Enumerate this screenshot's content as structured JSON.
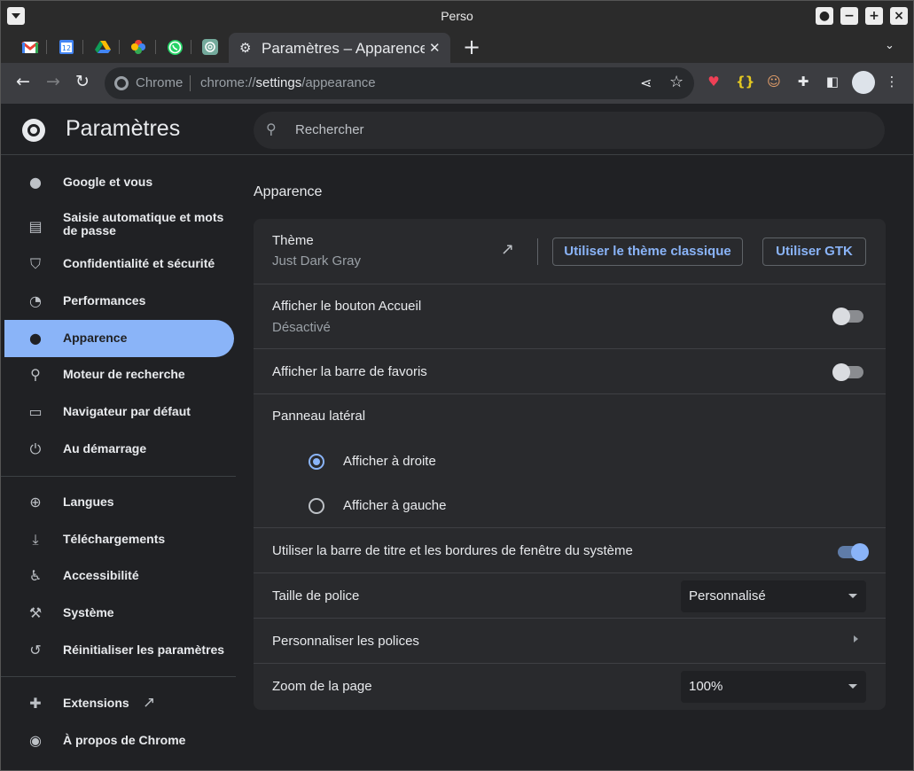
{
  "window": {
    "title": "Perso"
  },
  "tabs": {
    "pinned": [
      "gmail-icon",
      "calendar-icon",
      "drive-icon",
      "photos-icon",
      "whatsapp-icon",
      "chatgpt-icon"
    ],
    "active_title": "Paramètres – Apparence"
  },
  "toolbar": {
    "chrome_label": "Chrome",
    "url_scheme": "chrome://",
    "url_host": "settings",
    "url_path": "/appearance"
  },
  "header": {
    "title": "Paramètres",
    "search_placeholder": "Rechercher"
  },
  "sidebar": {
    "items": [
      {
        "label": "Google et vous",
        "icon": "person-icon"
      },
      {
        "label": "Saisie automatique et mots de passe",
        "icon": "clipboard-icon"
      },
      {
        "label": "Confidentialité et sécurité",
        "icon": "shield-icon"
      },
      {
        "label": "Performances",
        "icon": "gauge-icon"
      },
      {
        "label": "Apparence",
        "icon": "palette-icon"
      },
      {
        "label": "Moteur de recherche",
        "icon": "search-icon"
      },
      {
        "label": "Navigateur par défaut",
        "icon": "browser-icon"
      },
      {
        "label": "Au démarrage",
        "icon": "power-icon"
      },
      {
        "label": "Langues",
        "icon": "globe-icon"
      },
      {
        "label": "Téléchargements",
        "icon": "download-icon"
      },
      {
        "label": "Accessibilité",
        "icon": "accessibility-icon"
      },
      {
        "label": "Système",
        "icon": "wrench-icon"
      },
      {
        "label": "Réinitialiser les paramètres",
        "icon": "restore-icon"
      },
      {
        "label": "Extensions",
        "icon": "puzzle-icon"
      },
      {
        "label": "À propos de Chrome",
        "icon": "chrome-icon"
      }
    ]
  },
  "main": {
    "section_title": "Apparence",
    "theme": {
      "title": "Thème",
      "value": "Just Dark Gray",
      "classic_button": "Utiliser le thème classique",
      "gtk_button": "Utiliser GTK"
    },
    "home_button": {
      "title": "Afficher le bouton Accueil",
      "status": "Désactivé",
      "enabled": false
    },
    "bookmarks_bar": {
      "title": "Afficher la barre de favoris",
      "enabled": false
    },
    "side_panel": {
      "title": "Panneau latéral",
      "right": "Afficher à droite",
      "left": "Afficher à gauche",
      "selected": "right"
    },
    "system_titlebar": {
      "title": "Utiliser la barre de titre et les bordures de fenêtre du système",
      "enabled": true
    },
    "font_size": {
      "title": "Taille de police",
      "value": "Personnalisé"
    },
    "customize_fonts": {
      "title": "Personnaliser les polices"
    },
    "page_zoom": {
      "title": "Zoom de la page",
      "value": "100%"
    }
  },
  "colors": {
    "accent": "#8ab4f8",
    "background": "#202124",
    "card": "#292a2d"
  }
}
